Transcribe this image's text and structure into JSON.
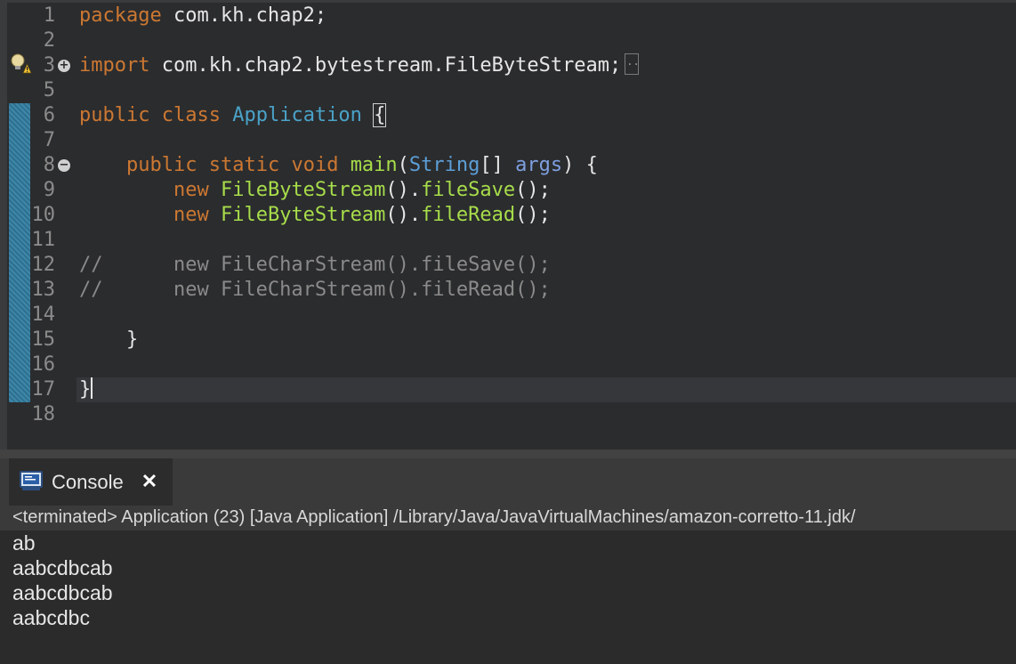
{
  "editor": {
    "lines": [
      {
        "num": "1",
        "segments": [
          {
            "t": "package",
            "c": "kw"
          },
          {
            "t": " com.kh.chap2;",
            "c": ""
          }
        ]
      },
      {
        "num": "2",
        "segments": []
      },
      {
        "num": "3",
        "segments": [
          {
            "t": "import",
            "c": "kw"
          },
          {
            "t": " com.kh.chap2.bytestream.FileByteStream;",
            "c": ""
          }
        ]
      },
      {
        "num": "5",
        "segments": []
      },
      {
        "num": "6",
        "segments": [
          {
            "t": "public",
            "c": "kw"
          },
          {
            "t": " ",
            "c": ""
          },
          {
            "t": "class",
            "c": "kw"
          },
          {
            "t": " ",
            "c": ""
          },
          {
            "t": "Application",
            "c": "cls"
          },
          {
            "t": " ",
            "c": ""
          },
          {
            "t": "{",
            "c": "brace-box"
          }
        ]
      },
      {
        "num": "7",
        "segments": []
      },
      {
        "num": "8",
        "segments": [
          {
            "t": "    ",
            "c": ""
          },
          {
            "t": "public",
            "c": "kw"
          },
          {
            "t": " ",
            "c": ""
          },
          {
            "t": "static",
            "c": "kw"
          },
          {
            "t": " ",
            "c": ""
          },
          {
            "t": "void",
            "c": "kw"
          },
          {
            "t": " ",
            "c": ""
          },
          {
            "t": "main",
            "c": "mth"
          },
          {
            "t": "(",
            "c": ""
          },
          {
            "t": "String",
            "c": "typ"
          },
          {
            "t": "[] ",
            "c": ""
          },
          {
            "t": "args",
            "c": "arg"
          },
          {
            "t": ") {",
            "c": ""
          }
        ]
      },
      {
        "num": "9",
        "segments": [
          {
            "t": "        ",
            "c": ""
          },
          {
            "t": "new",
            "c": "kw"
          },
          {
            "t": " ",
            "c": ""
          },
          {
            "t": "FileByteStream",
            "c": "mth"
          },
          {
            "t": "().",
            "c": ""
          },
          {
            "t": "fileSave",
            "c": "mth"
          },
          {
            "t": "();",
            "c": ""
          }
        ]
      },
      {
        "num": "10",
        "segments": [
          {
            "t": "        ",
            "c": ""
          },
          {
            "t": "new",
            "c": "kw"
          },
          {
            "t": " ",
            "c": ""
          },
          {
            "t": "FileByteStream",
            "c": "mth"
          },
          {
            "t": "().",
            "c": ""
          },
          {
            "t": "fileRead",
            "c": "mth"
          },
          {
            "t": "();",
            "c": ""
          }
        ]
      },
      {
        "num": "11",
        "segments": []
      },
      {
        "num": "12",
        "segments": [
          {
            "t": "//      new FileCharStream().fileSave();",
            "c": "cmt"
          }
        ]
      },
      {
        "num": "13",
        "segments": [
          {
            "t": "//      new FileCharStream().fileRead();",
            "c": "cmt"
          }
        ]
      },
      {
        "num": "14",
        "segments": []
      },
      {
        "num": "15",
        "segments": [
          {
            "t": "    }",
            "c": ""
          }
        ]
      },
      {
        "num": "16",
        "segments": []
      },
      {
        "num": "17",
        "segments": [
          {
            "t": "}",
            "c": ""
          }
        ]
      },
      {
        "num": "18",
        "segments": []
      }
    ]
  },
  "console": {
    "tab_label": "Console",
    "close_glyph": "✕",
    "header": "<terminated> Application (23) [Java Application] /Library/Java/JavaVirtualMachines/amazon-corretto-11.jdk/",
    "output": [
      "ab",
      "aabcdbcab",
      "aabcdbcab",
      "aabcdbc"
    ]
  },
  "icons": {
    "fold_expand": "+",
    "fold_collapse": "−"
  },
  "colors": {
    "keyword": "#cc7832",
    "class_name": "#4aa3c8",
    "method": "#a7dd4a",
    "comment": "#8a8a8a",
    "change_marker": "#2f6f8f"
  }
}
